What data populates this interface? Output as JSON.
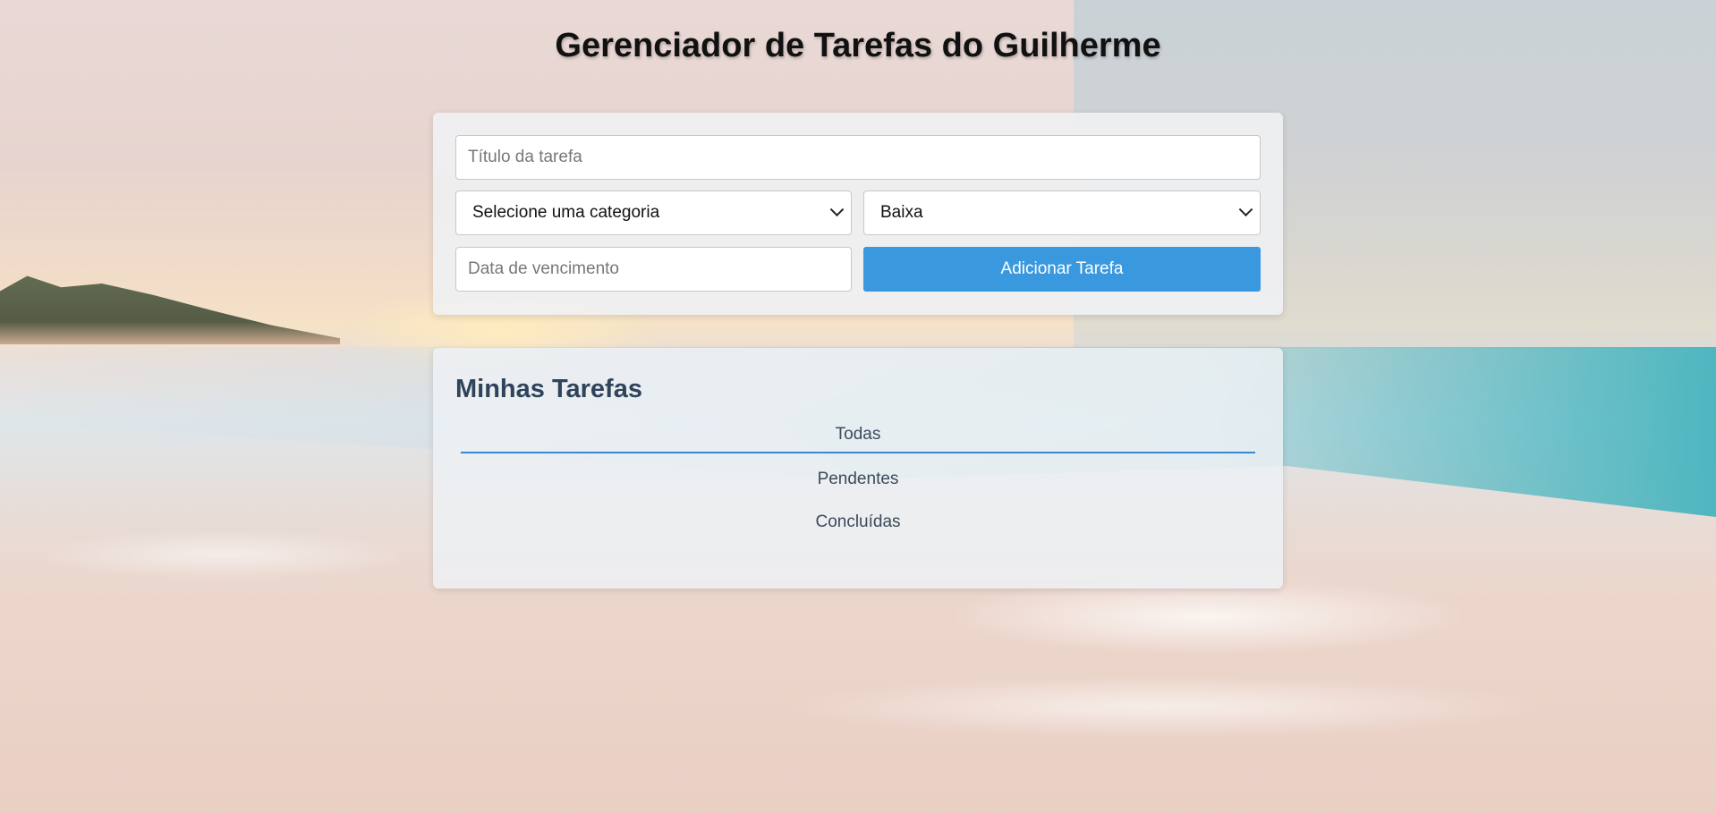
{
  "header": {
    "title": "Gerenciador de Tarefas do Guilherme"
  },
  "form": {
    "title_placeholder": "Título da tarefa",
    "category_selected": "Selecione uma categoria",
    "priority_selected": "Baixa",
    "due_date_placeholder": "Data de vencimento",
    "add_button_label": "Adicionar Tarefa"
  },
  "tasks": {
    "heading": "Minhas Tarefas",
    "filters": [
      {
        "label": "Todas",
        "active": true
      },
      {
        "label": "Pendentes",
        "active": false
      },
      {
        "label": "Concluídas",
        "active": false
      }
    ]
  },
  "colors": {
    "accent": "#3a98de",
    "heading": "#2f435a"
  }
}
